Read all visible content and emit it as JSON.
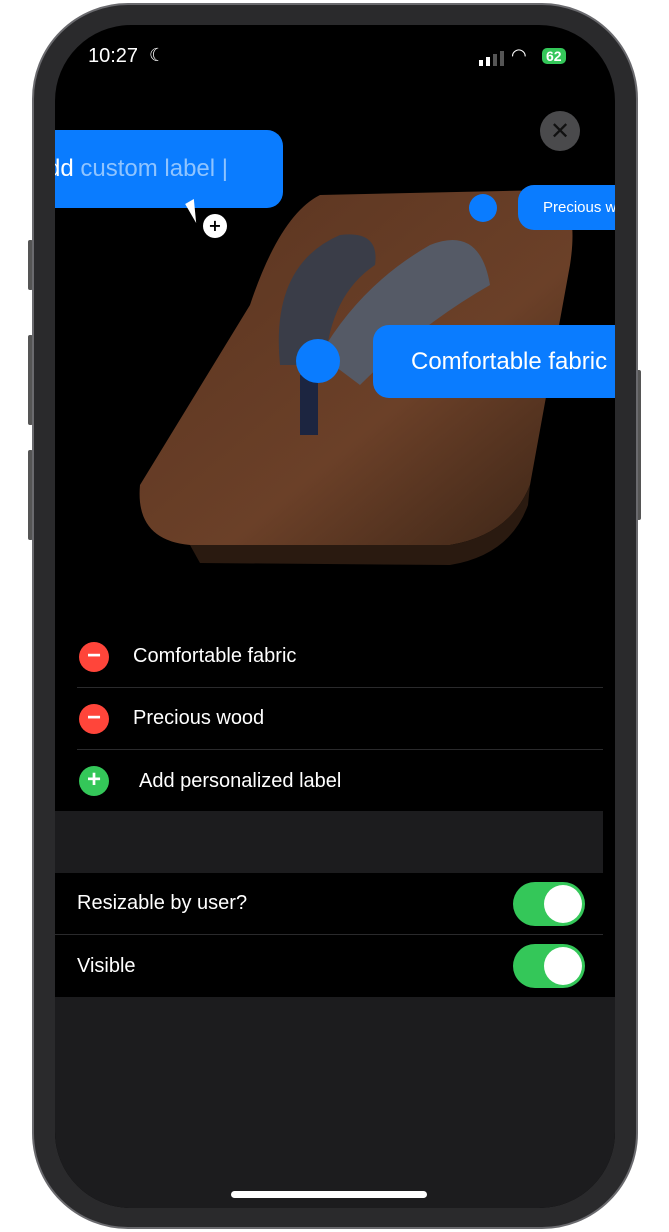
{
  "status_bar": {
    "time": "10:27",
    "battery": "62"
  },
  "annotations": {
    "custom_label_prefix": "Add",
    "custom_label_placeholder": "custom label |",
    "precious_wood": "Precious wood",
    "comfortable_fabric": "Comfortable fabric"
  },
  "labels_list": [
    {
      "label": "Comfortable fabric",
      "action": "remove"
    },
    {
      "label": "Precious wood",
      "action": "remove"
    },
    {
      "label": "Add personalized label",
      "action": "add"
    }
  ],
  "settings": [
    {
      "label": "Resizable by user?",
      "on": true
    },
    {
      "label": "Visible",
      "on": true
    }
  ],
  "colors": {
    "accent": "#0a7cff",
    "remove": "#ff453a",
    "add": "#34c759"
  }
}
